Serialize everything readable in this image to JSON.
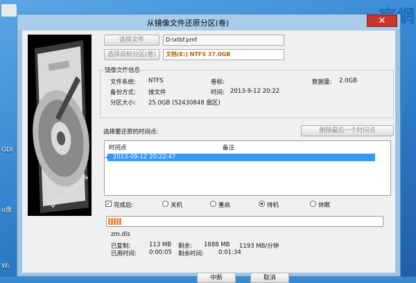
{
  "window": {
    "title": "从镜像文件还原分区(卷)",
    "close_label": "✕"
  },
  "desktop": {
    "brand_text": "ш官網",
    "labels": [
      "GDI",
      "u盘",
      "Wi"
    ]
  },
  "image_file": {
    "button_label": "选择文件",
    "path": "D:\\xtbf.pmf"
  },
  "target_partition": {
    "button_label": "选择目标分区(卷)",
    "value": "文档(E:) NTFS 37.0GB"
  },
  "info": {
    "group_title": "镜像文件信息",
    "fs_label": "文件系统:",
    "fs_value": "NTFS",
    "volume_label": "卷标:",
    "volume_value": "",
    "data_label": "数据量:",
    "data_value": "2.0GB",
    "backup_label": "备份方式:",
    "backup_value": "按文件",
    "time_label": "时间:",
    "time_value": "2013-9-12 20:22",
    "size_label": "分区大小:",
    "size_value": "25.0GB  (52430848 扇区)"
  },
  "timepoints": {
    "section_label": "选择要还原的时间点:",
    "delete_button": "删除最后一个时间点",
    "columns": [
      "时间点",
      "备注"
    ],
    "rows": [
      {
        "time": "2013-09-12 20:22:47",
        "note": ""
      }
    ]
  },
  "after_complete": {
    "label": "完成后:",
    "checked": true,
    "options": [
      "关机",
      "重启",
      "待机",
      "休眠"
    ],
    "selected": "待机"
  },
  "progress": {
    "fraction": 0.05,
    "current_file": "zm.dls",
    "copied_label": "已复制:",
    "copied_value": "113 MB",
    "remaining_label": "剩余:",
    "remaining_value": "1888 MB",
    "speed_value": "1193 MB/分钟",
    "elapsed_label": "已用时间:",
    "elapsed_value": "0:00:05",
    "time_left_label": "剩余时间:",
    "time_left_value": "0:01:34"
  },
  "buttons": {
    "interrupt": "中断",
    "cancel": "取消"
  },
  "image": {
    "disk_text": "DISK GENIUS"
  },
  "colors": {
    "accent": "#3399ff",
    "progress": "#f28a3c",
    "target_text": "#b35d00",
    "close": "#c7362f"
  }
}
